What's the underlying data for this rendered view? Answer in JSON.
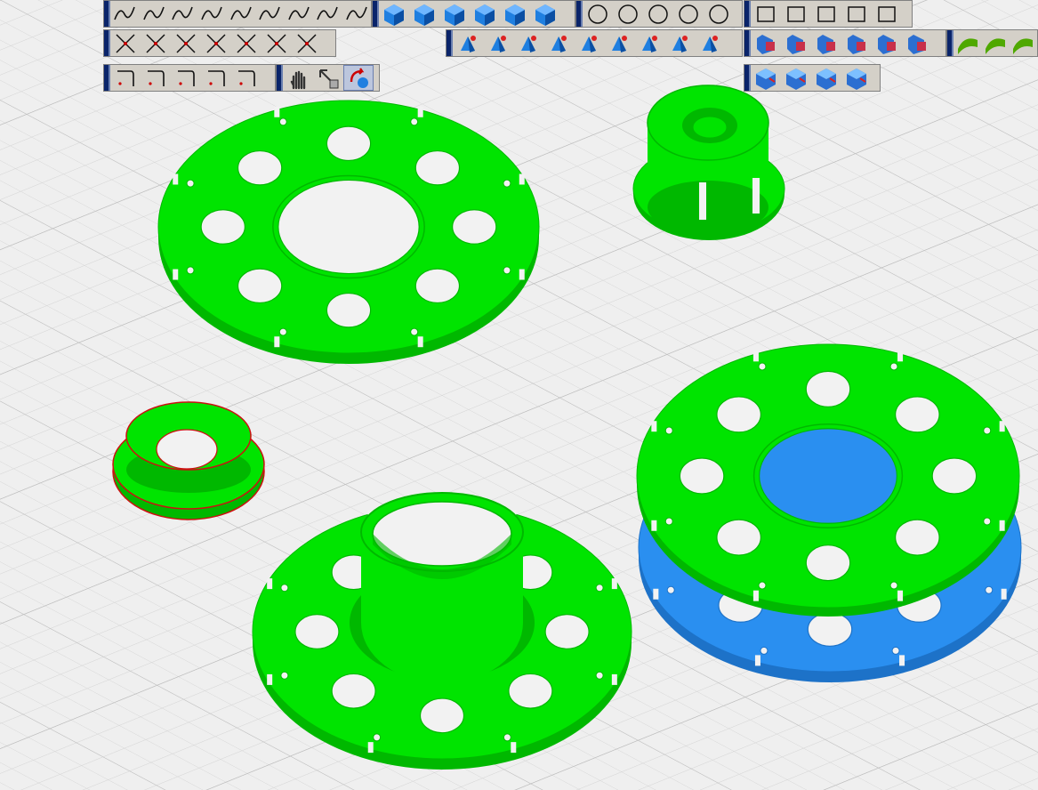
{
  "colors": {
    "viewport_bg": "#efefef",
    "grid": "#c9c9c9",
    "part_green": "#00e400",
    "part_green_dark": "#00b800",
    "part_blue": "#2a8ff0",
    "part_blue_dark": "#1d72c8",
    "selection_red": "#cc1111",
    "toolbar_bg": "#d4d0c8",
    "toolbar_grip": "#0a246a"
  },
  "toolbars": [
    {
      "id": "curves",
      "icons": [
        "spline-icon",
        "polyline-spline-icon",
        "arc-spline-icon",
        "wave-curve-icon",
        "spiral-icon",
        "split-curve-icon",
        "extend-curve-icon",
        "trim-curve-icon",
        "bezier-curve-icon"
      ]
    },
    {
      "id": "solids",
      "icons": [
        "box-solid-icon",
        "hex-prism-icon",
        "cube-icon",
        "boss-solid-icon",
        "pocket-solid-icon",
        "bend-solid-icon"
      ]
    },
    {
      "id": "circles",
      "icons": [
        "circle-icon",
        "circle-3pt-icon",
        "circle-center-icon",
        "circle-tangent-icon",
        "circle-tangent-2-icon"
      ]
    },
    {
      "id": "polygons",
      "icons": [
        "rectangle-icon",
        "hexagon-icon",
        "hexagon-center-icon",
        "chamfer-rectangle-icon",
        "fillet-rectangle-icon"
      ]
    },
    {
      "id": "intersect",
      "icons": [
        "intersect-icon",
        "cross-icon",
        "line-icon",
        "angle-bisector-icon",
        "angle-bisector-2-icon",
        "fillet-curve-icon",
        "corner-rectangle-icon"
      ]
    },
    {
      "id": "features",
      "icons": [
        "revolve-icon",
        "extrude-icon",
        "sweep-icon",
        "loft-icon",
        "shell-icon",
        "draft-icon",
        "rib-icon",
        "pipe-icon",
        "branch-pipe-icon"
      ]
    },
    {
      "id": "booleans",
      "icons": [
        "bool-add-icon",
        "bool-subtract-icon",
        "bool-intersect-icon",
        "bool-split-icon",
        "bool-remove-icon",
        "bool-explode-icon"
      ]
    },
    {
      "id": "surfaces",
      "icons": [
        "surface-point-icon",
        "surface-patch-icon",
        "surface-blend-icon"
      ]
    },
    {
      "id": "corners",
      "icons": [
        "corner-icon",
        "arch-corner-icon",
        "round-corner-icon",
        "offset-corner-icon",
        "chamfer-corner-icon"
      ]
    },
    {
      "id": "view",
      "icons": [
        "pan-hand-icon",
        "zoom-window-icon",
        "rotate-view-icon"
      ]
    },
    {
      "id": "solid-edit",
      "icons": [
        "solid-cut-icon",
        "solid-split-icon",
        "solid-color-icon",
        "solid-join-icon"
      ]
    }
  ]
}
